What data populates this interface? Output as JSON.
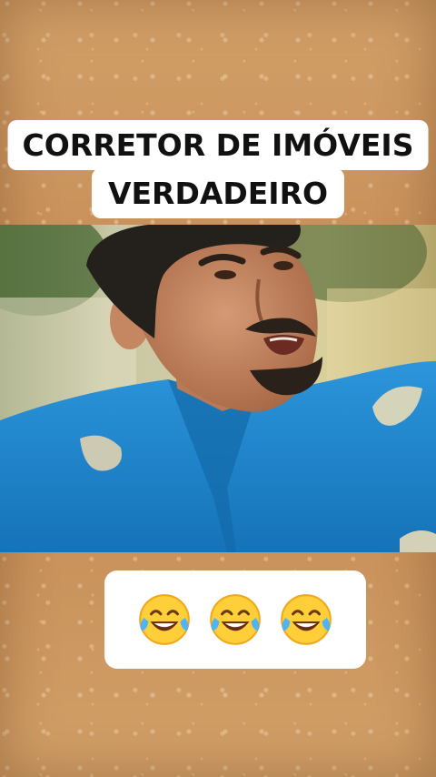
{
  "caption": {
    "line1": "CORRETOR DE IMÓVEIS",
    "line2": "VERDADEIRO"
  },
  "video": {
    "description_icon": "video-frame"
  },
  "reaction": {
    "emojis": [
      "face-with-tears-of-joy-icon",
      "face-with-tears-of-joy-icon",
      "face-with-tears-of-joy-icon"
    ]
  },
  "colors": {
    "background": "#c9955f",
    "caption_bg": "#ffffff",
    "caption_text": "#111111",
    "shirt": "#1f86cf"
  }
}
